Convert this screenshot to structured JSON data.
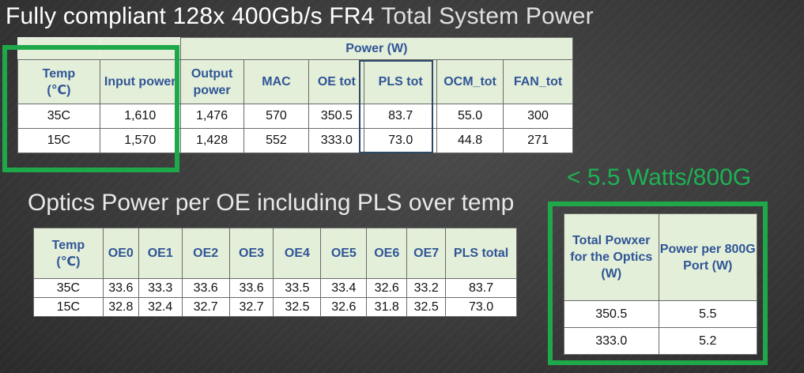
{
  "title": {
    "main": "Fully compliant 128x 400Gb/s FR4",
    "suffix": "Total System Power"
  },
  "subtitle": "Optics Power per OE including PLS over temp",
  "callout": "< 5.5 Watts/800G",
  "system_table": {
    "group_header": "Power (W)",
    "headers": {
      "temp": "Temp",
      "temp_unit": "(℃)",
      "input": "Input power",
      "output": "Output power",
      "mac": "MAC",
      "oe": "OE tot",
      "pls": "PLS tot",
      "ocm": "OCM_tot",
      "fan": "FAN_tot"
    },
    "rows": [
      {
        "temp": "35C",
        "input": "1,610",
        "output": "1,476",
        "mac": "570",
        "oe": "350.5",
        "pls": "83.7",
        "ocm": "55.0",
        "fan": "300"
      },
      {
        "temp": "15C",
        "input": "1,570",
        "output": "1,428",
        "mac": "552",
        "oe": "333.0",
        "pls": "73.0",
        "ocm": "44.8",
        "fan": "271"
      }
    ]
  },
  "oe_table": {
    "headers": {
      "temp": "Temp",
      "temp_unit": "(℃)",
      "oe0": "OE0",
      "oe1": "OE1",
      "oe2": "OE2",
      "oe3": "OE3",
      "oe4": "OE4",
      "oe5": "OE5",
      "oe6": "OE6",
      "oe7": "OE7",
      "pls": "PLS total"
    },
    "rows": [
      {
        "temp": "35C",
        "oe0": "33.6",
        "oe1": "33.3",
        "oe2": "33.6",
        "oe3": "33.6",
        "oe4": "33.5",
        "oe5": "33.4",
        "oe6": "32.6",
        "oe7": "33.2",
        "pls": "83.7"
      },
      {
        "temp": "15C",
        "oe0": "32.8",
        "oe1": "32.4",
        "oe2": "32.7",
        "oe3": "32.7",
        "oe4": "32.5",
        "oe5": "32.6",
        "oe6": "31.8",
        "oe7": "32.5",
        "pls": "73.0"
      }
    ]
  },
  "port_table": {
    "headers": {
      "total": "Total Powxer for the Optics (W)",
      "per_port": "Power per 800G Port (W)"
    },
    "rows": [
      {
        "total": "350.5",
        "per_port": "5.5"
      },
      {
        "total": "333.0",
        "per_port": "5.2"
      }
    ]
  },
  "colors": {
    "accent_green": "#1fa84a",
    "callout_green": "#1db254",
    "header_bg": "#e4efd9",
    "header_text": "#2f5596"
  }
}
